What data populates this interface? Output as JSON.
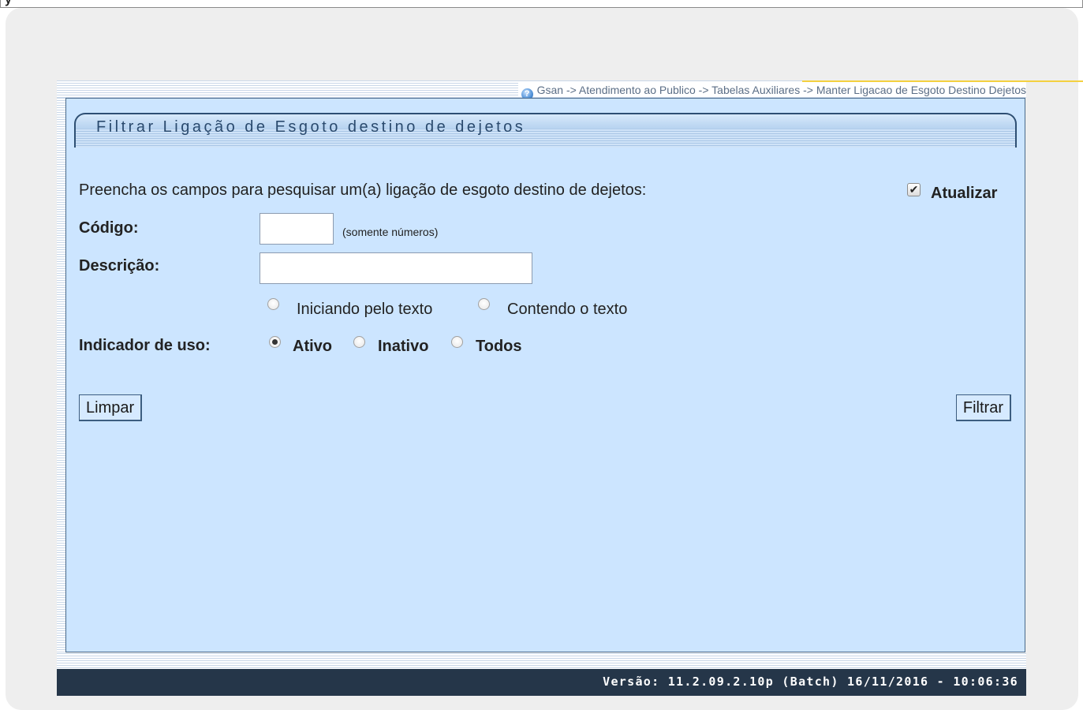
{
  "top_strip": {
    "glyph": "y"
  },
  "breadcrumb": {
    "text": "Gsan -> Atendimento ao Publico -> Tabelas Auxiliares -> Manter Ligacao de Esgoto Destino Dejetos",
    "help_icon": "help-icon"
  },
  "form": {
    "title": "Filtrar Ligação de Esgoto destino de dejetos",
    "instructions": "Preencha os campos para pesquisar um(a) ligação de esgoto destino de dejetos:",
    "atualizar": {
      "label": "Atualizar",
      "checked": true
    },
    "codigo": {
      "label": "Código:",
      "value": "",
      "hint": "(somente números)"
    },
    "descricao": {
      "label": "Descrição:",
      "value": ""
    },
    "search_mode": {
      "options": [
        "Iniciando pelo texto",
        "Contendo o texto"
      ],
      "selected": null
    },
    "indicador_uso": {
      "label": "Indicador de uso:",
      "options": [
        "Ativo",
        "Inativo",
        "Todos"
      ],
      "selected": "Ativo"
    },
    "buttons": {
      "clear": "Limpar",
      "filter": "Filtrar"
    }
  },
  "footer": {
    "version": "Versão: 11.2.09.2.10p (Batch) 16/11/2016 - 10:06:36"
  },
  "colors": {
    "panel_bg": "#cce5ff",
    "title_text": "#2a4a6e",
    "footer_bg": "#253649",
    "breadcrumb_text": "#5b6e86",
    "accent_gold": "#f4d03f"
  }
}
